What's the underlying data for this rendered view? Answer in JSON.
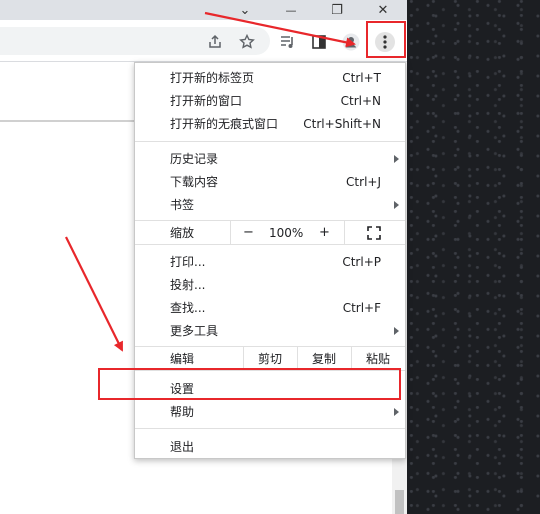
{
  "window_controls": {
    "dropdown_glyph": "⌄",
    "minimize_glyph": "—",
    "restore_glyph": "❐",
    "close_glyph": "✕"
  },
  "toolbar_icons": [
    "share-icon",
    "star-icon",
    "media-icon",
    "sidepanel-icon",
    "profile-icon",
    "kebab-menu-icon"
  ],
  "menu": {
    "new_tab": {
      "label": "打开新的标签页",
      "shortcut": "Ctrl+T"
    },
    "new_window": {
      "label": "打开新的窗口",
      "shortcut": "Ctrl+N"
    },
    "incognito": {
      "label": "打开新的无痕式窗口",
      "shortcut": "Ctrl+Shift+N"
    },
    "history": {
      "label": "历史记录"
    },
    "downloads": {
      "label": "下载内容",
      "shortcut": "Ctrl+J"
    },
    "bookmarks": {
      "label": "书签"
    },
    "zoom": {
      "label": "缩放",
      "minus": "−",
      "value": "100%",
      "plus": "+"
    },
    "print": {
      "label": "打印...",
      "shortcut": "Ctrl+P"
    },
    "cast": {
      "label": "投射..."
    },
    "find": {
      "label": "查找...",
      "shortcut": "Ctrl+F"
    },
    "more_tools": {
      "label": "更多工具"
    },
    "edit": {
      "label": "编辑",
      "cut": "剪切",
      "copy": "复制",
      "paste": "粘贴"
    },
    "settings": {
      "label": "设置"
    },
    "help": {
      "label": "帮助"
    },
    "exit": {
      "label": "退出"
    }
  },
  "colors": {
    "annotation_red": "#e8272b",
    "chrome_gray": "#dee1e6",
    "menu_text": "#202124"
  }
}
